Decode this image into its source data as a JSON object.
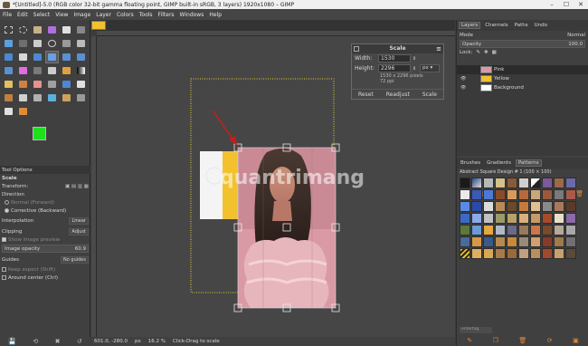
{
  "window": {
    "title": "*[Untitled]-5.0 (RGB color 32-bit gamma floating point, GIMP built-in sRGB, 3 layers) 1920x1080 – GIMP",
    "controls": [
      "–",
      "☐",
      "✕"
    ]
  },
  "menu": {
    "items": [
      "File",
      "Edit",
      "Select",
      "View",
      "Image",
      "Layer",
      "Colors",
      "Tools",
      "Filters",
      "Windows",
      "Help"
    ]
  },
  "tool_options": {
    "tab_label": "Tool Options",
    "tool_name": "Scale",
    "transform_label": "Transform:",
    "direction_label": "Direction",
    "direction_normal": "Normal (Forward)",
    "direction_corrective": "Corrective (Backward)",
    "interpolation_label": "Interpolation",
    "interpolation_value": "Linear",
    "clipping_label": "Clipping",
    "clipping_value": "Adjust",
    "show_preview": "Show image preview",
    "opacity_label": "Image opacity",
    "opacity_value": "60.9",
    "guides_label": "Guides",
    "guides_value": "No guides",
    "keep_aspect": "Keep aspect (Shift)",
    "around_center": "Around center (Ctrl)"
  },
  "scale_dialog": {
    "title": "Scale",
    "width_label": "Width:",
    "width_value": "1530",
    "height_label": "Height:",
    "height_value": "2296",
    "unit": "px",
    "dims": "1530 x 2296 pixels",
    "resolution": "72 ppi",
    "reset_label": "Reset",
    "readjust_label": "Readjust",
    "scale_label": "Scale"
  },
  "status_bar": {
    "coords": "601.0, -280.0",
    "unit": "px",
    "zoom": "16.2 %",
    "message": "Click-Drag to scale"
  },
  "layers_panel": {
    "tabs": [
      "Layers",
      "Channels",
      "Paths",
      "Undo"
    ],
    "mode_label": "Mode",
    "mode_value": "Normal",
    "opacity_label": "Opacity",
    "opacity_value": "100.0",
    "lock_label": "Lock:",
    "layers": [
      {
        "name": "Pink",
        "visible": false,
        "selected": true,
        "color": "#d99aa5"
      },
      {
        "name": "Yellow",
        "visible": true,
        "selected": false,
        "color": "#f2c12e"
      },
      {
        "name": "Background",
        "visible": true,
        "selected": false,
        "color": "#ffffff"
      }
    ]
  },
  "brushes_panel": {
    "tabs": [
      "Brushes",
      "Gradients",
      "Patterns"
    ],
    "pattern_name": "Abstract Square Design # 1 (100 × 100)",
    "search_placeholder": "entertag"
  },
  "watermark": "quantrimang",
  "colors": {
    "foreground": "#1ee01e",
    "background": "#ffffff",
    "accent_orange": "#e08a3a",
    "arrow_red": "#cc1b1b"
  }
}
